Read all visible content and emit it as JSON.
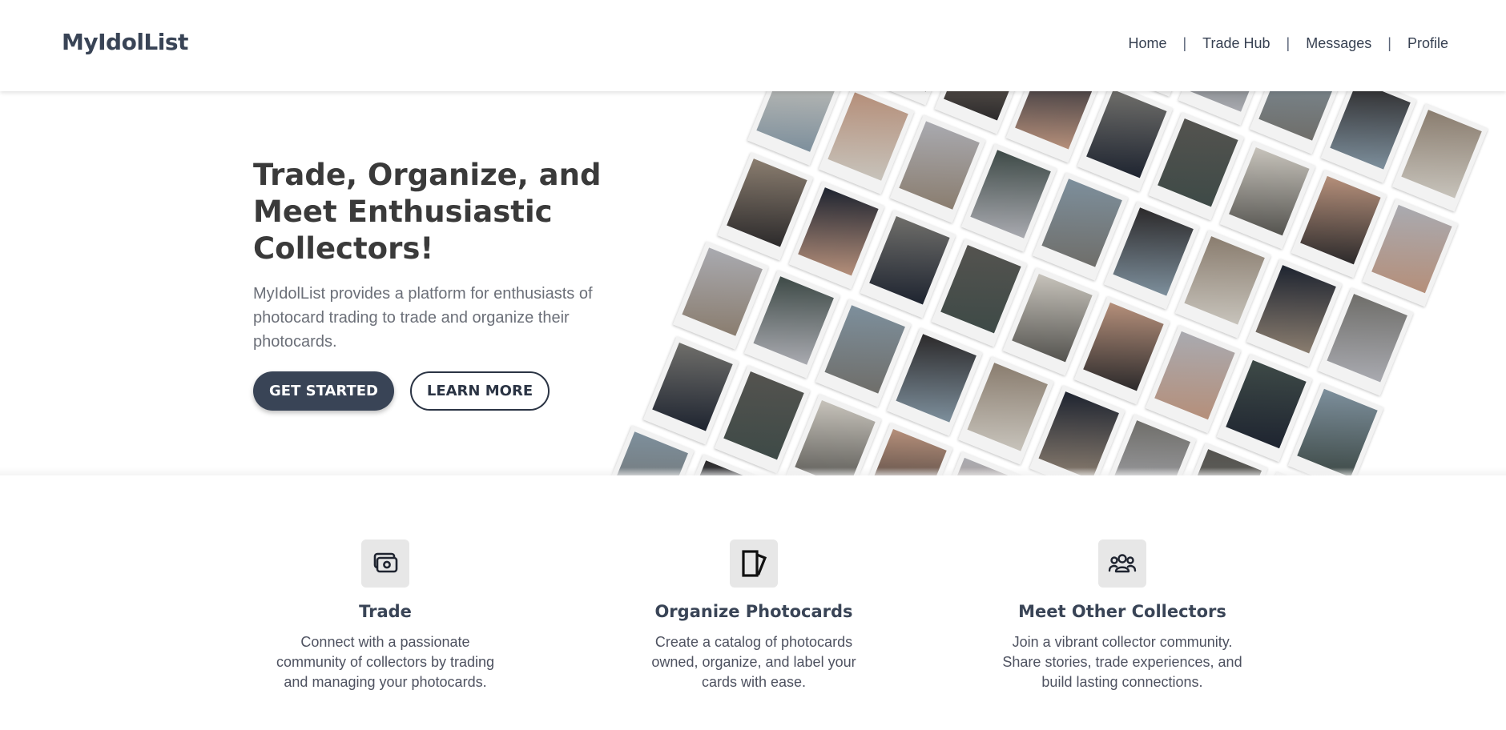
{
  "header": {
    "logo": "MyIdolList",
    "nav": [
      {
        "label": "Home"
      },
      {
        "label": "Trade Hub"
      },
      {
        "label": "Messages"
      },
      {
        "label": "Profile"
      }
    ],
    "separator": "|"
  },
  "hero": {
    "title": "Trade, Organize, and Meet Enthusiastic Collectors!",
    "description": "MyIdolList provides a platform for enthusiasts of photocard trading to trade and organize their photocards.",
    "primary_button": "GET STARTED",
    "secondary_button": "LEARN MORE",
    "collage_label": "photocard-collage"
  },
  "features": [
    {
      "icon": "money-icon",
      "title": "Trade",
      "description": "Connect with a passionate community of collectors by trading and managing your photocards."
    },
    {
      "icon": "photocards-icon",
      "title": "Organize Photocards",
      "description": "Create a catalog of photocards owned, organize, and label your cards with ease."
    },
    {
      "icon": "group-icon",
      "title": "Meet Other Collectors",
      "description": "Join a vibrant collector community. Share stories, trade experiences, and build lasting connections."
    }
  ],
  "colors": {
    "brand": "#394456",
    "card_tones": [
      "#6f6e6a",
      "#2c2a2b",
      "#a9aab0",
      "#54534f",
      "#8a7d6f",
      "#3e4a47",
      "#c7c3bb",
      "#1e2430",
      "#7d8f9c",
      "#b58f7a"
    ]
  }
}
